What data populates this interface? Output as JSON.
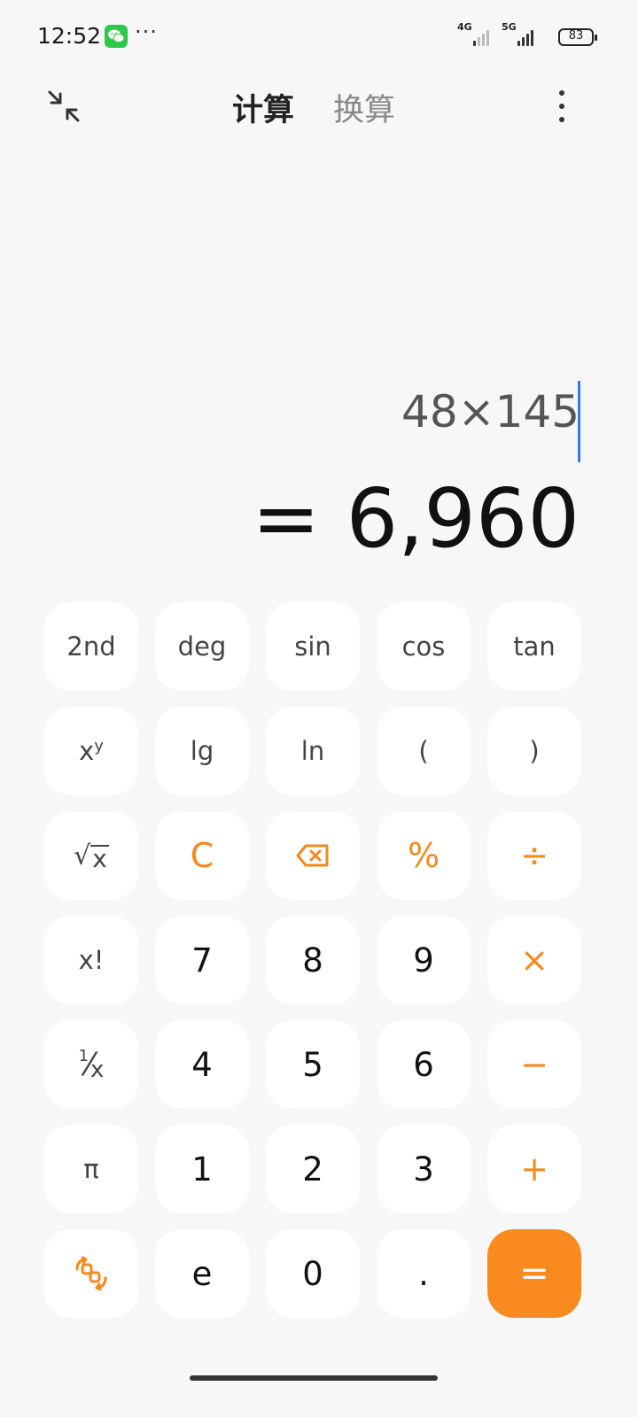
{
  "status_bar": {
    "time": "12:52",
    "more": "···",
    "signal1_label": "4G",
    "signal2_label": "5G",
    "battery": "83",
    "wechat_color": "#2ec84a"
  },
  "header": {
    "tabs": [
      {
        "label": "计算",
        "active": true
      },
      {
        "label": "换算",
        "active": false
      }
    ]
  },
  "display": {
    "expression": "48×145",
    "result": "= 6,960",
    "cursor_color": "#3478f6"
  },
  "keypad": {
    "row1": [
      "2nd",
      "deg",
      "sin",
      "cos",
      "tan"
    ],
    "row2": {
      "xy_base": "x",
      "xy_exp": "y",
      "lg": "lg",
      "ln": "ln",
      "lparen": "(",
      "rparen": ")"
    },
    "row3": {
      "sqrt_var": "x",
      "clear": "C",
      "percent": "%",
      "divide": "÷"
    },
    "row4": {
      "factorial": "x!",
      "seven": "7",
      "eight": "8",
      "nine": "9",
      "multiply": "×"
    },
    "row5": {
      "recip_num": "1",
      "recip_den": "x",
      "four": "4",
      "five": "5",
      "six": "6",
      "minus": "−"
    },
    "row6": {
      "pi": "π",
      "one": "1",
      "two": "2",
      "three": "3",
      "plus": "+"
    },
    "row7": {
      "e": "e",
      "zero": "0",
      "dot": ".",
      "equals": "="
    }
  },
  "colors": {
    "accent": "#f88a1f",
    "operator": "#f28a1e",
    "background": "#f7f7f7",
    "key": "#ffffff"
  }
}
